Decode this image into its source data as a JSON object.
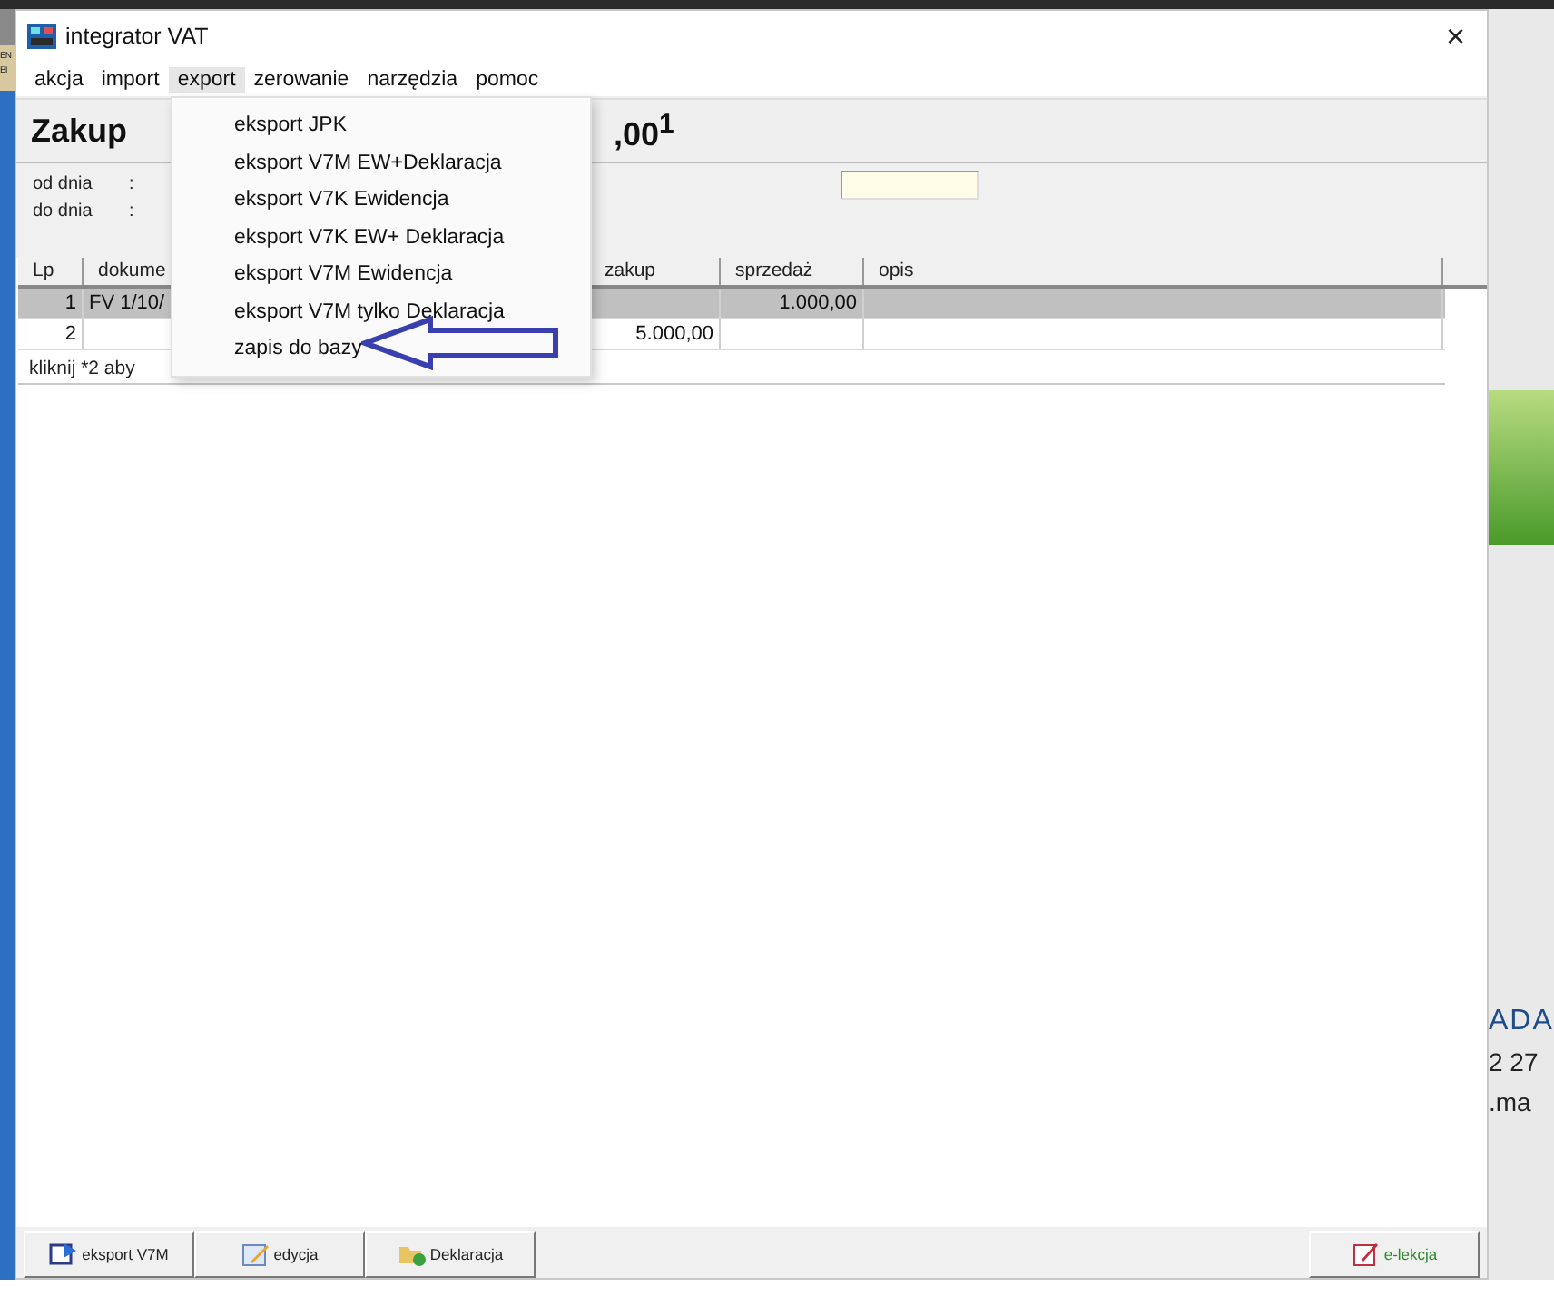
{
  "background": {
    "left_texts": [
      "EN",
      "BI"
    ],
    "right_texts": [
      "ADA",
      "2 27",
      ".ma"
    ]
  },
  "window": {
    "title": "integrator VAT",
    "close": "×"
  },
  "menubar": [
    {
      "label": "akcja",
      "selected": false
    },
    {
      "label": "import",
      "selected": false
    },
    {
      "label": "export",
      "selected": true
    },
    {
      "label": "zerowanie",
      "selected": false
    },
    {
      "label": "narzędzia",
      "selected": false
    },
    {
      "label": "pomoc",
      "selected": false
    }
  ],
  "dropdown": [
    "eksport JPK",
    "eksport V7M EW+Deklaracja",
    "eksport V7K Ewidencja",
    "eksport V7K EW+ Deklaracja",
    "eksport V7M Ewidencja",
    "eksport V7M tylko Deklaracja",
    "zapis do bazy"
  ],
  "header": {
    "title": "Zakup",
    "amount": ",00$^{1}$"
  },
  "filters": [
    {
      "label": "od dnia",
      "sep": ":"
    },
    {
      "label": "do dnia",
      "sep": ":"
    }
  ],
  "table": {
    "columns": [
      "Lp",
      "dokume",
      "",
      "zakup",
      "sprzedaż",
      "opis"
    ],
    "rows": [
      {
        "cells": [
          "1",
          "FV 1/10/",
          "",
          "",
          "1.000,00",
          ""
        ],
        "selected": true
      },
      {
        "cells": [
          "2",
          "",
          "",
          "5.000,00",
          "",
          ""
        ],
        "selected": false
      }
    ],
    "hint": "kliknij *2 aby"
  },
  "buttons": [
    {
      "label": "eksport V7M",
      "kind": "export"
    },
    {
      "label": "edycja",
      "kind": "edit"
    },
    {
      "label": "Deklaracja",
      "kind": "declaration"
    },
    {
      "label": "e-lekcja",
      "kind": "lesson"
    }
  ]
}
